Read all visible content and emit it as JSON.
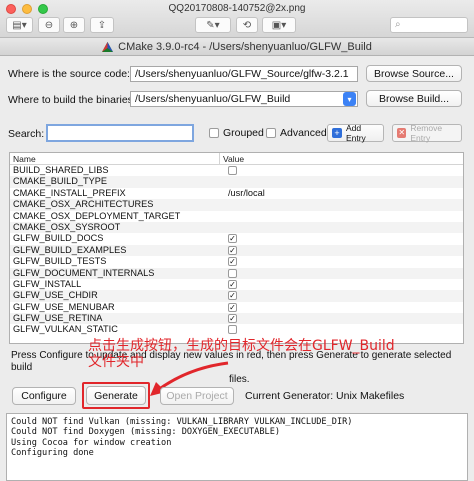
{
  "preview": {
    "title": "QQ20170808-140752@2x.png"
  },
  "window": {
    "title": "CMake 3.9.0-rc4 - /Users/shenyuanluo/GLFW_Build"
  },
  "source": {
    "label": "Where is the source code:",
    "value": "/Users/shenyuanluo/GLFW_Source/glfw-3.2.1",
    "browse_label": "Browse Source..."
  },
  "build": {
    "label": "Where to build the binaries:",
    "value": "/Users/shenyuanluo/GLFW_Build",
    "browse_label": "Browse Build..."
  },
  "search": {
    "label": "Search:",
    "value": "",
    "grouped_label": "Grouped",
    "advanced_label": "Advanced",
    "add_entry_label": "Add Entry",
    "remove_entry_label": "Remove Entry"
  },
  "table": {
    "headers": [
      "Name",
      "Value"
    ],
    "rows": [
      {
        "name": "BUILD_SHARED_LIBS",
        "value": "",
        "checkbox": true,
        "checked": false
      },
      {
        "name": "CMAKE_BUILD_TYPE",
        "value": "",
        "checkbox": false,
        "checked": false
      },
      {
        "name": "CMAKE_INSTALL_PREFIX",
        "value": "/usr/local",
        "checkbox": false,
        "checked": false
      },
      {
        "name": "CMAKE_OSX_ARCHITECTURES",
        "value": "",
        "checkbox": false,
        "checked": false
      },
      {
        "name": "CMAKE_OSX_DEPLOYMENT_TARGET",
        "value": "",
        "checkbox": false,
        "checked": false
      },
      {
        "name": "CMAKE_OSX_SYSROOT",
        "value": "",
        "checkbox": false,
        "checked": false
      },
      {
        "name": "GLFW_BUILD_DOCS",
        "value": "",
        "checkbox": true,
        "checked": true
      },
      {
        "name": "GLFW_BUILD_EXAMPLES",
        "value": "",
        "checkbox": true,
        "checked": true
      },
      {
        "name": "GLFW_BUILD_TESTS",
        "value": "",
        "checkbox": true,
        "checked": true
      },
      {
        "name": "GLFW_DOCUMENT_INTERNALS",
        "value": "",
        "checkbox": true,
        "checked": false
      },
      {
        "name": "GLFW_INSTALL",
        "value": "",
        "checkbox": true,
        "checked": true
      },
      {
        "name": "GLFW_USE_CHDIR",
        "value": "",
        "checkbox": true,
        "checked": true
      },
      {
        "name": "GLFW_USE_MENUBAR",
        "value": "",
        "checkbox": true,
        "checked": true
      },
      {
        "name": "GLFW_USE_RETINA",
        "value": "",
        "checkbox": true,
        "checked": true
      },
      {
        "name": "GLFW_VULKAN_STATIC",
        "value": "",
        "checkbox": true,
        "checked": false
      }
    ]
  },
  "info": {
    "line1": "Press Configure to update and display new values in red, then press Generate to generate selected build",
    "line2": "files."
  },
  "annotation": {
    "line1": "点击生成按钮，生成的目标文件会在GLFW_Build",
    "line2": "文件夹中",
    "color": "#e1262b"
  },
  "buttons": {
    "configure": "Configure",
    "generate": "Generate",
    "open_project": "Open Project"
  },
  "generator": {
    "label": "Current Generator: Unix Makefiles"
  },
  "output": {
    "lines": [
      "Could NOT find Vulkan (missing: VULKAN_LIBRARY VULKAN_INCLUDE_DIR)",
      "Could NOT find Doxygen (missing: DOXYGEN_EXECUTABLE)",
      "Using Cocoa for window creation",
      "Configuring done"
    ]
  }
}
